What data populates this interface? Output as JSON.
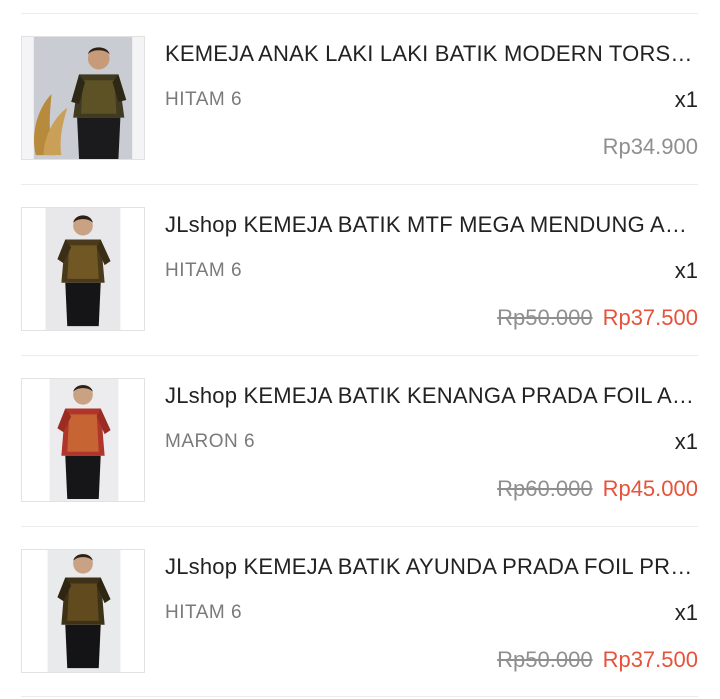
{
  "items": [
    {
      "name": "KEMEJA ANAK LAKI LAKI BATIK MODERN TORSO ANAK",
      "variant": "HITAM 6",
      "quantity": "x1",
      "original_price": "",
      "price": "Rp34.900",
      "image": "boy-batik-shirt-black-photo"
    },
    {
      "name": "JLshop KEMEJA BATIK MTF MEGA MENDUNG ANAK",
      "variant": "HITAM 6",
      "quantity": "x1",
      "original_price": "Rp50.000",
      "price": "Rp37.500",
      "image": "boy-batik-shirt-brown-photo"
    },
    {
      "name": "JLshop KEMEJA BATIK KENANGA PRADA FOIL ANAK",
      "variant": "MARON 6",
      "quantity": "x1",
      "original_price": "Rp60.000",
      "price": "Rp45.000",
      "image": "boy-batik-shirt-red-photo"
    },
    {
      "name": "JLshop KEMEJA BATIK AYUNDA PRADA FOIL PRIA ANAK",
      "variant": "HITAM 6",
      "quantity": "x1",
      "original_price": "Rp50.000",
      "price": "Rp37.500",
      "image": "boy-batik-shirt-dark-photo"
    }
  ],
  "colors": {
    "sale_price": "#e5533a",
    "muted_text": "#8f8f8f",
    "divider": "#ececec"
  }
}
